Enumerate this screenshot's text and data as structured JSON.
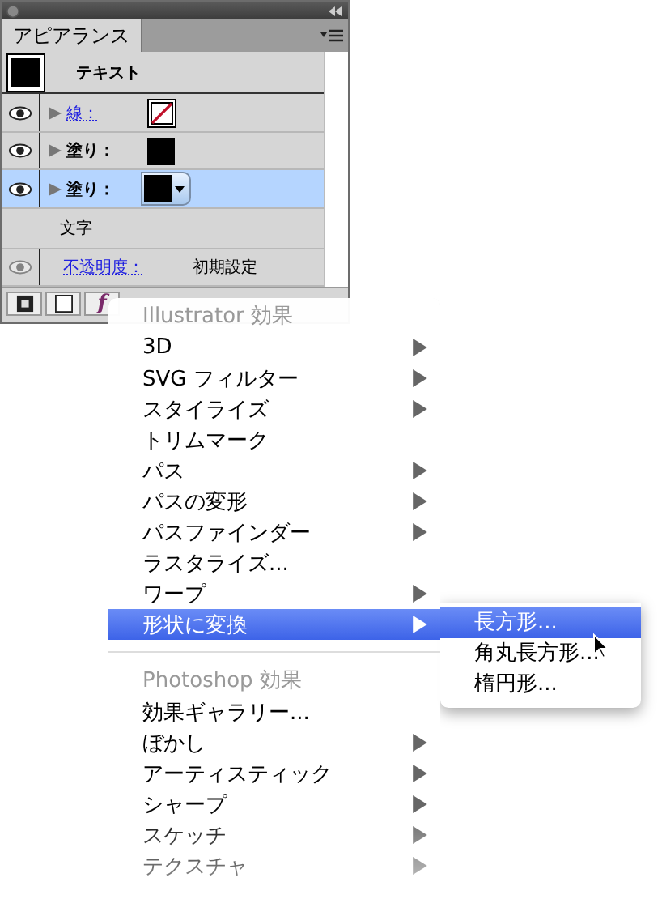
{
  "panel": {
    "title": "アピアランス",
    "rows": [
      {
        "kind": "object",
        "label": "テキスト",
        "selected": false
      },
      {
        "kind": "attribute",
        "label": "線：",
        "link": true,
        "swatch": {
          "kind": "none"
        },
        "dropdown": false,
        "selected": false
      },
      {
        "kind": "attribute",
        "label": "塗り：",
        "link": false,
        "swatch": {
          "kind": "black"
        },
        "dropdown": false,
        "selected": false
      },
      {
        "kind": "attribute",
        "label": "塗り：",
        "link": false,
        "swatch": {
          "kind": "black"
        },
        "dropdown": true,
        "selected": true
      },
      {
        "kind": "group",
        "label": "文字",
        "selected": false
      },
      {
        "kind": "opacity",
        "label": "不透明度：",
        "value": "初期設定",
        "link": true,
        "selected": false
      }
    ],
    "toolbar_fx": "f"
  },
  "menu": {
    "items": [
      {
        "kind": "header",
        "label": "Illustrator 効果"
      },
      {
        "kind": "item",
        "label": "3D",
        "submenu": true,
        "selected": false
      },
      {
        "kind": "item",
        "label": "SVG フィルター",
        "submenu": true,
        "selected": false
      },
      {
        "kind": "item",
        "label": "スタイライズ",
        "submenu": true,
        "selected": false
      },
      {
        "kind": "item",
        "label": "トリムマーク",
        "submenu": false,
        "selected": false
      },
      {
        "kind": "item",
        "label": "パス",
        "submenu": true,
        "selected": false
      },
      {
        "kind": "item",
        "label": "パスの変形",
        "submenu": true,
        "selected": false
      },
      {
        "kind": "item",
        "label": "パスファインダー",
        "submenu": true,
        "selected": false
      },
      {
        "kind": "item",
        "label": "ラスタライズ...",
        "submenu": false,
        "selected": false
      },
      {
        "kind": "item",
        "label": "ワープ",
        "submenu": true,
        "selected": false
      },
      {
        "kind": "item",
        "label": "形状に変換",
        "submenu": true,
        "selected": true
      },
      {
        "kind": "separator"
      },
      {
        "kind": "header",
        "label": "Photoshop 効果"
      },
      {
        "kind": "item",
        "label": "効果ギャラリー...",
        "submenu": false,
        "selected": false
      },
      {
        "kind": "item",
        "label": "ぼかし",
        "submenu": true,
        "selected": false
      },
      {
        "kind": "item",
        "label": "アーティスティック",
        "submenu": true,
        "selected": false
      },
      {
        "kind": "item",
        "label": "シャープ",
        "submenu": true,
        "selected": false
      },
      {
        "kind": "item",
        "label": "スケッチ",
        "submenu": true,
        "selected": false
      },
      {
        "kind": "item",
        "label": "テクスチャ",
        "submenu": true,
        "selected": false
      }
    ]
  },
  "submenu": {
    "items": [
      {
        "label": "長方形...",
        "selected": true
      },
      {
        "label": "角丸長方形...",
        "selected": false
      },
      {
        "label": "楕円形...",
        "selected": false
      }
    ]
  }
}
